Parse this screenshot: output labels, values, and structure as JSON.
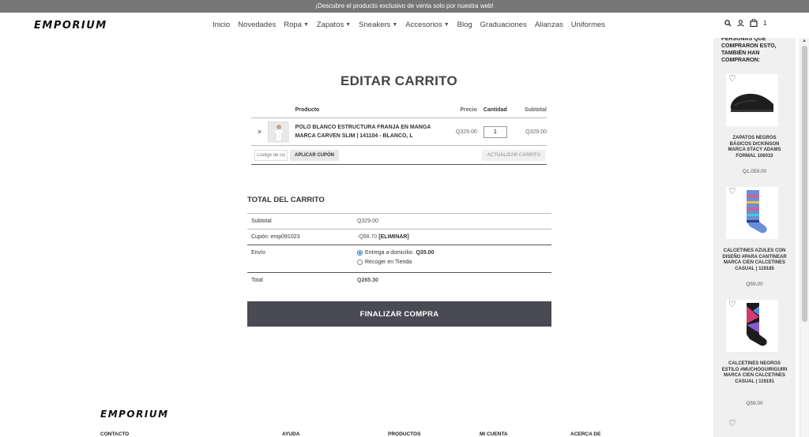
{
  "announcement": "¡Descubre el producto exclusivo de venta solo por nuestra web!",
  "brand": "EMPORIUM",
  "nav": [
    "Inicio",
    "Novedades",
    "Ropa",
    "Zapatos",
    "Sneakers",
    "Accesorios",
    "Blog",
    "Graduaciones",
    "Alianzas",
    "Uniformes"
  ],
  "header": {
    "cart_count": "1",
    "icons": [
      "search-icon",
      "user-icon",
      "bag-icon"
    ]
  },
  "page_title": "EDITAR CARRITO",
  "cart": {
    "headers": {
      "product": "Producto",
      "price": "Precio",
      "qty": "Cantidad",
      "subtotal": "Subtotal"
    },
    "row": {
      "remove": "×",
      "name": "POLO BLANCO ESTRUCTURA FRANJA EN MANGA MARCA CARVEN SLIM | 141104 - BLANCO, L",
      "price": "Q329.00",
      "qty": "1",
      "subtotal": "Q329.00"
    },
    "coupon_placeholder": "Código de cupón",
    "apply_label": "APLICAR CUPÓN",
    "update_label": "ACTUALIZAR CARRITO"
  },
  "totals": {
    "title": "TOTAL DEL CARRITO",
    "subtotal_label": "Subtotal",
    "subtotal_value": "Q329.00",
    "coupon_label": "Cupón: emp091023",
    "coupon_value": "-Q98.70",
    "coupon_remove": "[ELIMINAR]",
    "shipping_label": "Envío",
    "ship_home_label": "Entrega a domicilio:",
    "ship_home_price": "Q35.00",
    "ship_pickup_label": "Recoger en Tienda",
    "total_label": "Total",
    "total_value": "Q265.30"
  },
  "checkout_label": "FINALIZAR COMPRA",
  "footer": {
    "cols": [
      "CONTACTO",
      "AYUDA",
      "PRODUCTOS",
      "MI CUENTA",
      "ACERCA DE"
    ]
  },
  "sidebar": {
    "title": "PERSONAS QUE COMPRARON ESTO, TAMBIÉN HAN COMPRARON:",
    "items": [
      {
        "name": "ZAPATOS NEGROS BÁSICOS DICKINSON MARCA STACY ADAMS FORMAL 106033",
        "price": "Q1,059.00"
      },
      {
        "name": "CALCETINES AZULES CON DISEÑO #PARA CANTINEAR MARCA CIEN CALCETINES CASUAL | 119185",
        "price": "Q59.00"
      },
      {
        "name": "CALCETINES NEGROS ESTILO #MUCHOGUIRIGUIRI MARCA CIEN CALCETINES CASUAL | 119191",
        "price": "Q59.00"
      }
    ]
  },
  "colors": {
    "topbar": "#767676",
    "checkout": "#4a4a52",
    "radio": "#2a7dd1"
  }
}
